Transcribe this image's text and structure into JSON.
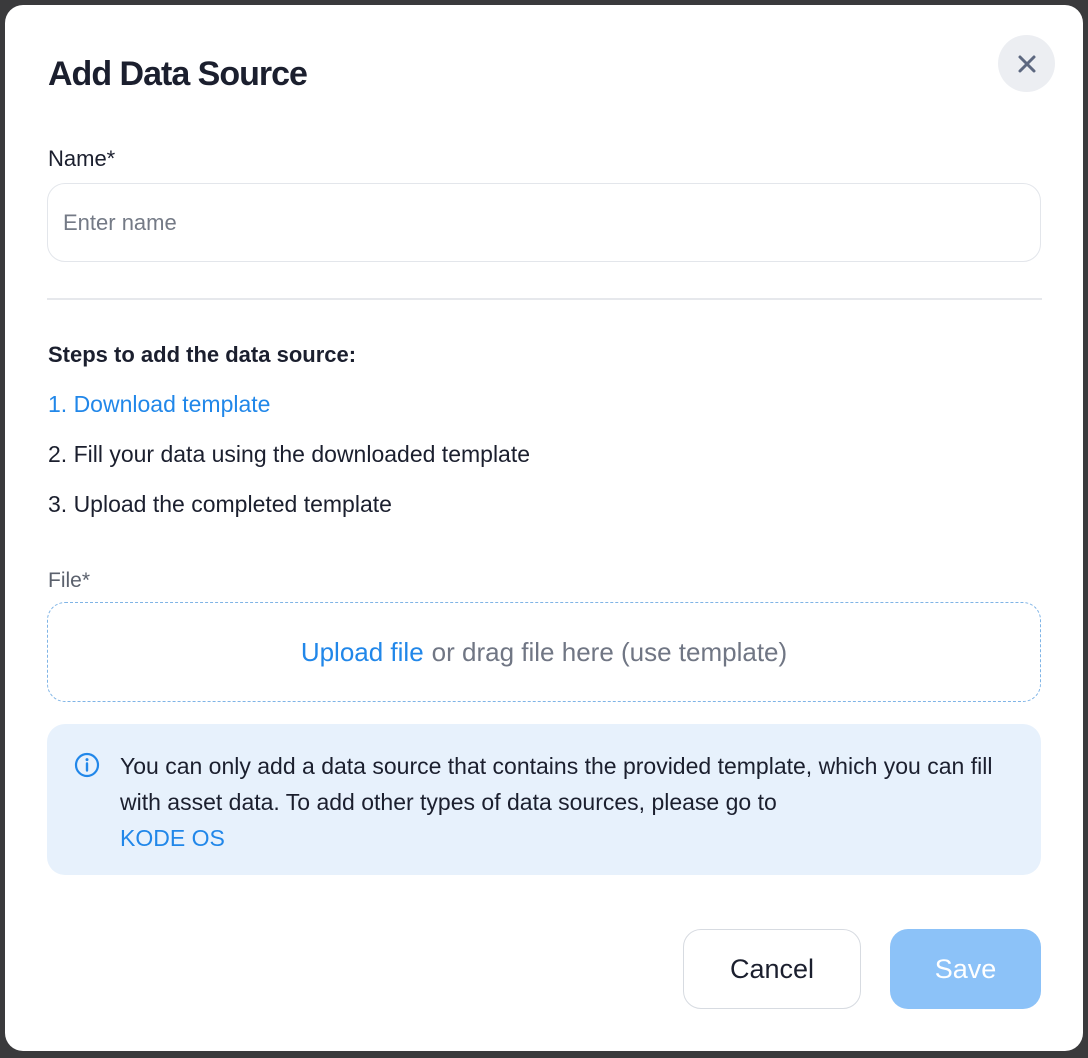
{
  "dialog": {
    "title": "Add Data Source"
  },
  "name_field": {
    "label": "Name*",
    "placeholder": "Enter name",
    "value": ""
  },
  "steps": {
    "heading": "Steps to add the data source:",
    "items": [
      "1. Download template",
      "2. Fill your data using the downloaded template",
      "3. Upload the completed template"
    ]
  },
  "file_field": {
    "label": "File*",
    "upload_link": "Upload file",
    "drop_text": "or drag file here (use template)"
  },
  "info": {
    "text": "You can only add a data source that contains the provided template, which you can fill with asset data. To add other types of data sources, please go to",
    "link": "KODE OS",
    "icon": "info-icon"
  },
  "buttons": {
    "cancel": "Cancel",
    "save": "Save"
  },
  "colors": {
    "accent": "#2187e9",
    "save_disabled": "#8cc2f8",
    "info_background": "#e7f1fc"
  },
  "icons": {
    "close": "close-icon"
  }
}
